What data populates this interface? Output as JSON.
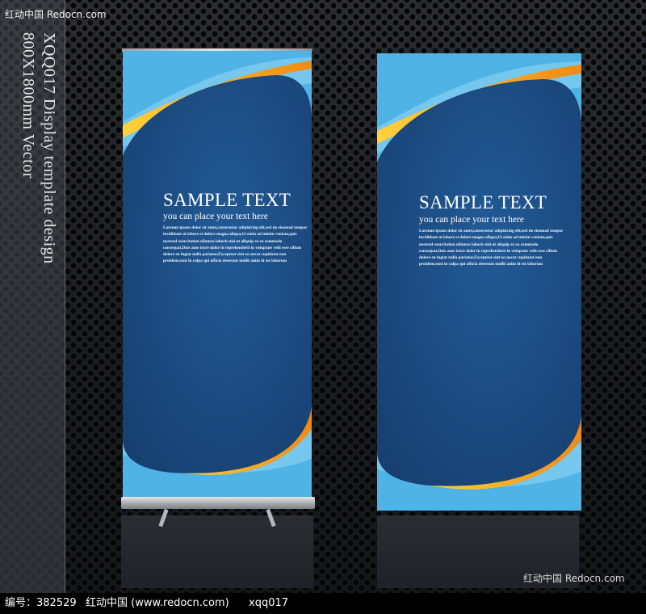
{
  "sidebar": {
    "vertical_lines": [
      "XQQ017 Display template design",
      "800X1800mm Vector"
    ]
  },
  "watermarks": {
    "top_left": "红动中国 Redocn.com",
    "bottom_right": "红动中国 Redocn.com"
  },
  "banners": [
    {
      "title": "SAMPLE TEXT",
      "subtitle": "you can place your text here",
      "body": "Loremm ipsum dolor sit amet,consectetur adipisicing elit,sed do eiusmod tempor\nincididunt ut labore et dolore magna aliqua,Ut enim ad minim veniam,quis\nnostrud exercitation ullamco laboris nisi ut aliquip ex ea commodo\nconsequat,Duis aute irure dolor in reprehenderit in voluptate velit esse cillum\ndolore eu fugiat nulla pariatur,Excepteur sint occaecat cupidatat non\nproident,sunt in culpa qui officia deserunt mollit anim id est laborum"
    },
    {
      "title": "SAMPLE TEXT",
      "subtitle": "you can place your text here",
      "body": "Loremm ipsum dolor sit amet,consectetur adipisicing elit,sed do eiusmod tempor\nincididunt ut labore et dolore magna aliqua,Ut enim ad minim veniam,quis\nnostrud exercitation ullamco laboris nisi ut aliquip ex ea commodo\nconsequat,Duis aute irure dolor in reprehenderit in voluptate velit esse cillum\ndolore eu fugiat nulla pariatur,Excepteur sint occaecat cupidatat non\nproident,sunt in culpa qui officia deserunt mollit anim id est laborum"
    }
  ],
  "footer": {
    "id_text": "编号：382529",
    "site_text": "红动中国 (www.redocn.com)",
    "code_text": "xqq017"
  },
  "colors": {
    "banner_light_blue": "#4fb3e6",
    "banner_dark_blue": "#1d4f86",
    "accent_yellow": "#f6b81b",
    "accent_orange": "#f08a12"
  }
}
